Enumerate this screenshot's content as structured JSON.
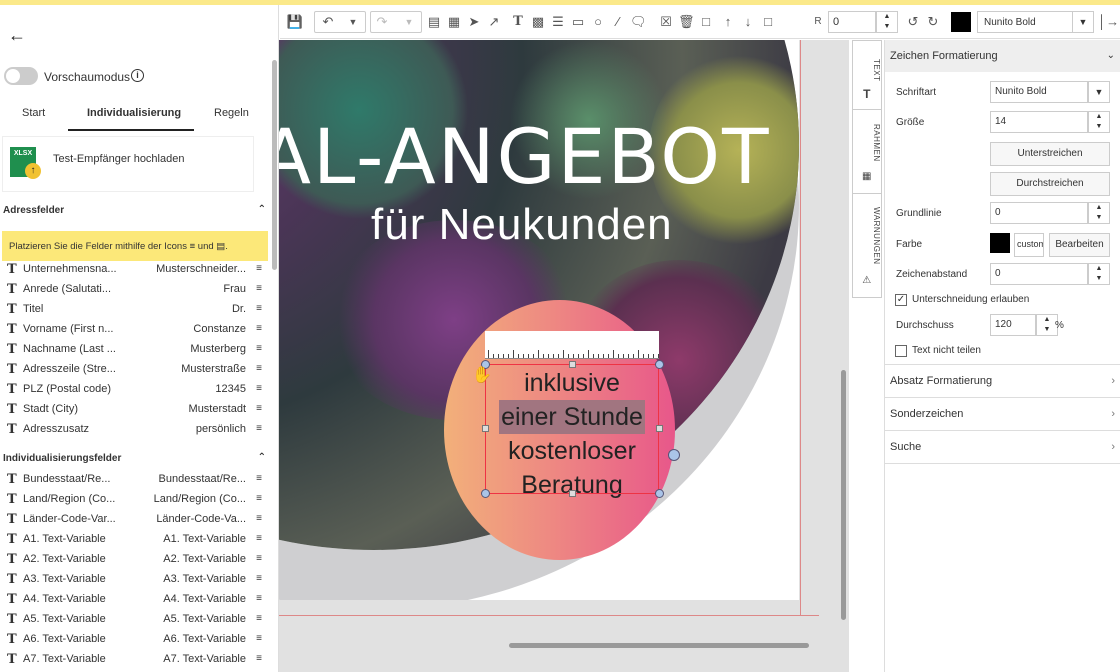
{
  "left": {
    "preview_label": "Vorschaumodus",
    "tabs": [
      "Start",
      "Individualisierung",
      "Regeln"
    ],
    "upload_label": "Test-Empfänger hochladen",
    "xlsx_badge": "XLSX",
    "section_address": "Adressfelder",
    "hint": "Platzieren Sie die Felder mithilfe der Icons",
    "hint_and": "und",
    "address_rows": [
      {
        "name": "Unternehmensna...",
        "value": "Musterschneider..."
      },
      {
        "name": "Anrede (Salutati...",
        "value": "Frau"
      },
      {
        "name": "Titel",
        "value": "Dr."
      },
      {
        "name": "Vorname (First n...",
        "value": "Constanze"
      },
      {
        "name": "Nachname (Last ...",
        "value": "Musterberg"
      },
      {
        "name": "Adresszeile (Stre...",
        "value": "Musterstraße"
      },
      {
        "name": "PLZ (Postal code)",
        "value": "12345"
      },
      {
        "name": "Stadt (City)",
        "value": "Musterstadt"
      },
      {
        "name": "Adresszusatz",
        "value": "persönlich"
      }
    ],
    "section_custom": "Individualisierungsfelder",
    "custom_rows": [
      {
        "name": "Bundesstaat/Re...",
        "value": "Bundesstaat/Re..."
      },
      {
        "name": "Land/Region (Co...",
        "value": "Land/Region (Co..."
      },
      {
        "name": "Länder-Code-Var...",
        "value": "Länder-Code-Va..."
      },
      {
        "name": "A1. Text-Variable",
        "value": "A1. Text-Variable"
      },
      {
        "name": "A2. Text-Variable",
        "value": "A2. Text-Variable"
      },
      {
        "name": "A3. Text-Variable",
        "value": "A3. Text-Variable"
      },
      {
        "name": "A4. Text-Variable",
        "value": "A4. Text-Variable"
      },
      {
        "name": "A5. Text-Variable",
        "value": "A5. Text-Variable"
      },
      {
        "name": "A6. Text-Variable",
        "value": "A6. Text-Variable"
      },
      {
        "name": "A7. Text-Variable",
        "value": "A7. Text-Variable"
      }
    ]
  },
  "toolbar": {
    "rotation_label": "R",
    "rotation_value": "0",
    "font": "Nunito Bold"
  },
  "canvas": {
    "headline": "AL-ANGEBOT",
    "subline": "für Neukunden",
    "circle_lines": [
      "inklusive",
      "einer Stunde",
      "kostenloser",
      "Beratung"
    ]
  },
  "sidetabs": [
    "TEXT",
    "RAHMEN",
    "WARNUNGEN"
  ],
  "right": {
    "header": "Zeichen Formatierung",
    "font_label": "Schriftart",
    "font_value": "Nunito Bold",
    "size_label": "Größe",
    "size_value": "14",
    "underline_btn": "Unterstreichen",
    "strike_btn": "Durchstreichen",
    "baseline_label": "Grundlinie",
    "baseline_value": "0",
    "color_label": "Farbe",
    "color_custom": "custom",
    "color_edit": "Bearbeiten",
    "spacing_label": "Zeichenabstand",
    "spacing_value": "0",
    "kerning_label": "Unterschneidung erlauben",
    "leading_label": "Durchschuss",
    "leading_value": "120",
    "leading_unit": "%",
    "nosplit_label": "Text nicht teilen",
    "accordions": [
      "Absatz Formatierung",
      "Sonderzeichen",
      "Suche"
    ]
  }
}
